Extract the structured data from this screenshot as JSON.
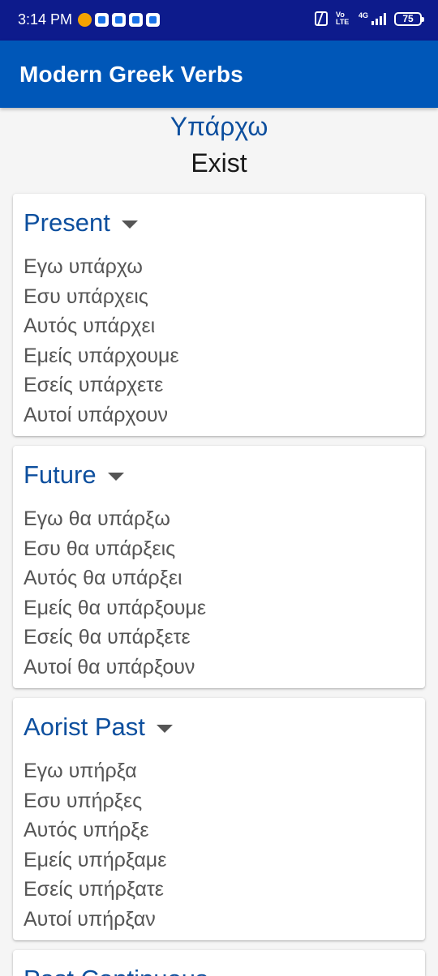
{
  "status_bar": {
    "time": "3:14 PM",
    "notification_icons": [
      "coin-icon",
      "chat-icon",
      "youtube-icon",
      "audio-icon",
      "settings-app-icon"
    ],
    "volte": "Vo LTE",
    "network": "4G",
    "battery": "75"
  },
  "app_bar": {
    "title": "Modern Greek Verbs"
  },
  "verb": {
    "greek": "Υπάρχω",
    "english": "Exist"
  },
  "tenses": [
    {
      "title": "Present",
      "forms": [
        "Εγω υπάρχω",
        "Εσυ υπάρχεις",
        "Αυτός υπάρχει",
        "Εμείς υπάρχουμε",
        "Εσείς υπάρχετε",
        "Αυτοί υπάρχουν"
      ]
    },
    {
      "title": "Future",
      "forms": [
        "Εγω θα υπάρξω",
        "Εσυ θα υπάρξεις",
        "Αυτός θα υπάρξει",
        "Εμείς θα υπάρξουμε",
        "Εσείς θα υπάρξετε",
        "Αυτοί θα υπάρξουν"
      ]
    },
    {
      "title": "Aorist Past",
      "forms": [
        "Εγω υπήρξα",
        "Εσυ υπήρξες",
        "Αυτός υπήρξε",
        "Εμείς υπήρξαμε",
        "Εσείς υπήρξατε",
        "Αυτοί υπήρξαν"
      ]
    },
    {
      "title": "Past Continuous",
      "forms": []
    }
  ],
  "colors": {
    "status_bar": "#0d1b8c",
    "app_bar": "#0057b8",
    "accent_text": "#0d4f9e",
    "background": "#f5f5f5"
  }
}
